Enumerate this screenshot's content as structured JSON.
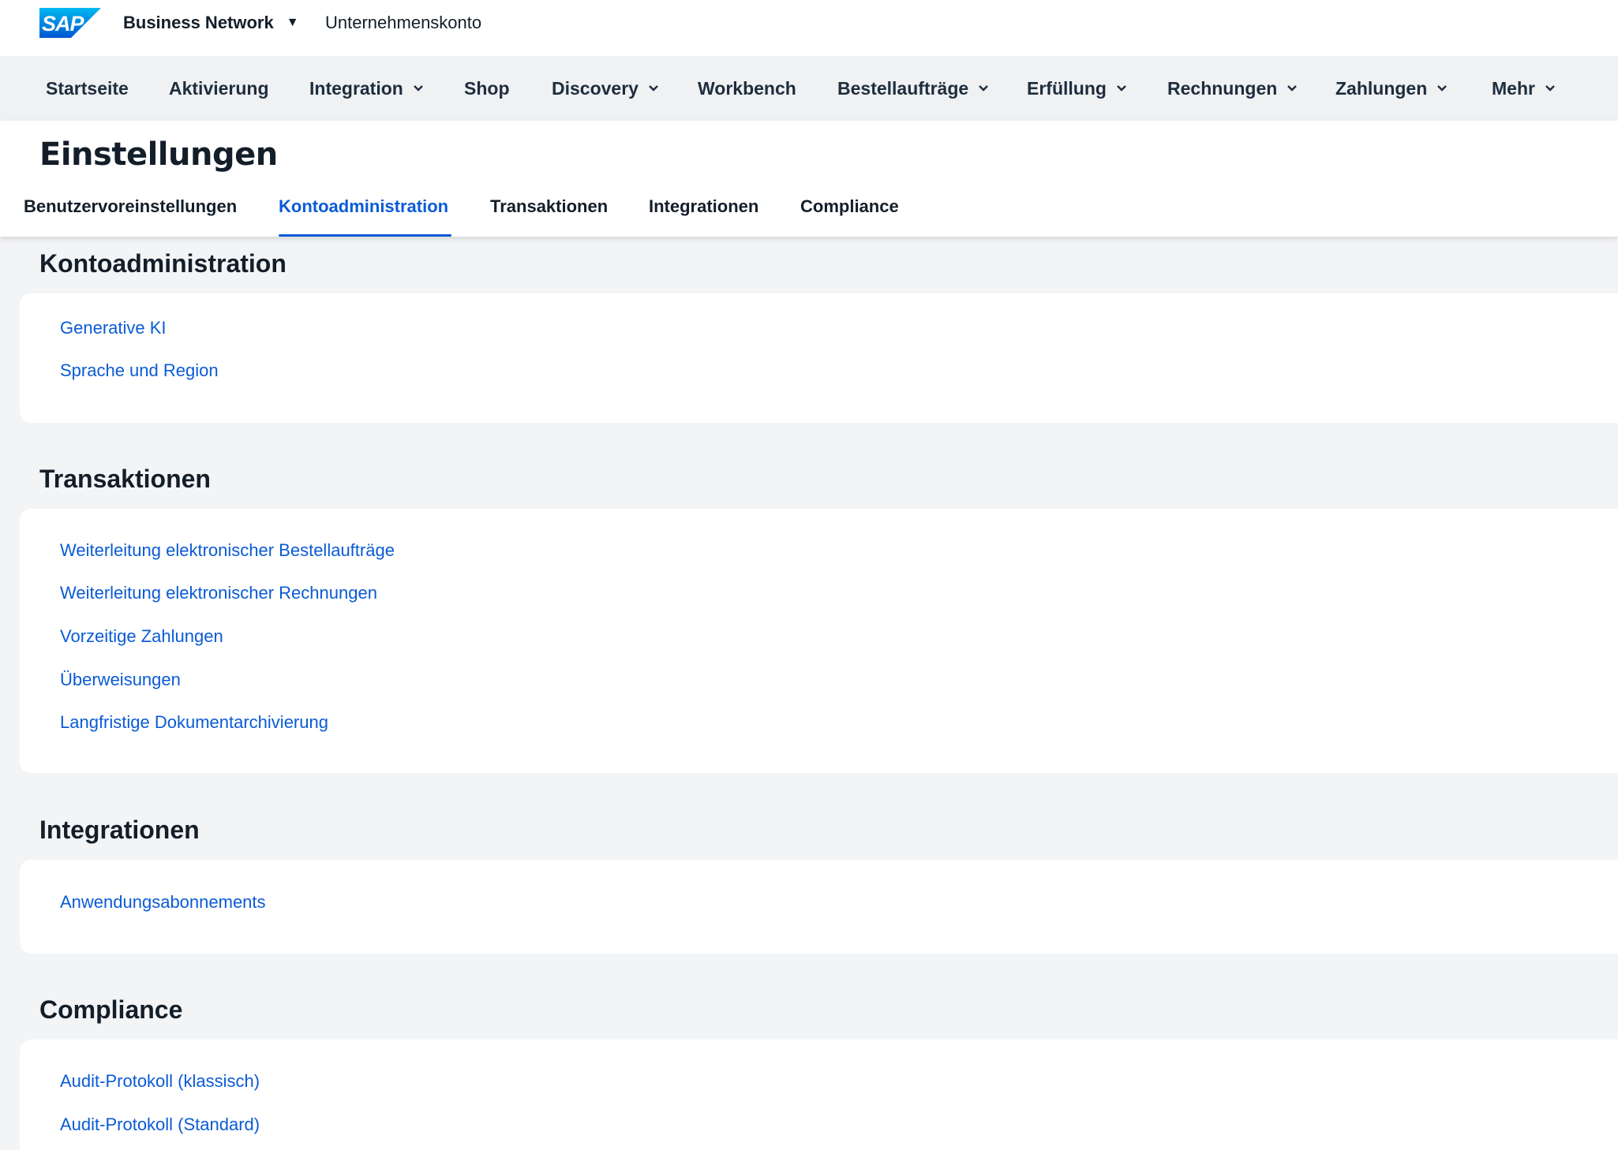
{
  "shell": {
    "product": "Business Network",
    "account": "Unternehmenskonto",
    "brand_color": "#0a6ed1"
  },
  "topnav": [
    {
      "label": "Startseite",
      "has_menu": false
    },
    {
      "label": "Aktivierung",
      "has_menu": false
    },
    {
      "label": "Integration",
      "has_menu": true
    },
    {
      "label": "Shop",
      "has_menu": false
    },
    {
      "label": "Discovery",
      "has_menu": true
    },
    {
      "label": "Workbench",
      "has_menu": false
    },
    {
      "label": "Bestellaufträge",
      "has_menu": true
    },
    {
      "label": "Erfüllung",
      "has_menu": true
    },
    {
      "label": "Rechnungen",
      "has_menu": true
    },
    {
      "label": "Zahlungen",
      "has_menu": true
    },
    {
      "label": "Mehr",
      "has_menu": true
    }
  ],
  "page": {
    "title": "Einstellungen",
    "tabs": [
      {
        "label": "Benutzervoreinstellungen",
        "active": false
      },
      {
        "label": "Kontoadministration",
        "active": true
      },
      {
        "label": "Transaktionen",
        "active": false
      },
      {
        "label": "Integrationen",
        "active": false
      },
      {
        "label": "Compliance",
        "active": false
      }
    ]
  },
  "sections": {
    "kontoadministration": {
      "title": "Kontoadministration",
      "links": [
        "Generative KI",
        "Sprache und Region"
      ]
    },
    "transaktionen": {
      "title": "Transaktionen",
      "links": [
        "Weiterleitung elektronischer Bestellaufträge",
        "Weiterleitung elektronischer Rechnungen",
        "Vorzeitige Zahlungen",
        "Überweisungen",
        "Langfristige Dokumentarchivierung"
      ]
    },
    "integrationen": {
      "title": "Integrationen",
      "links": [
        "Anwendungsabonnements"
      ]
    },
    "compliance": {
      "title": "Compliance",
      "links": [
        "Audit-Protokoll (klassisch)",
        "Audit-Protokoll (Standard)"
      ]
    }
  },
  "colors": {
    "link": "#0a5bd6",
    "active_tab": "#0a5bd6",
    "background": "#f3f4f6",
    "nav_background": "#eff1f2"
  }
}
